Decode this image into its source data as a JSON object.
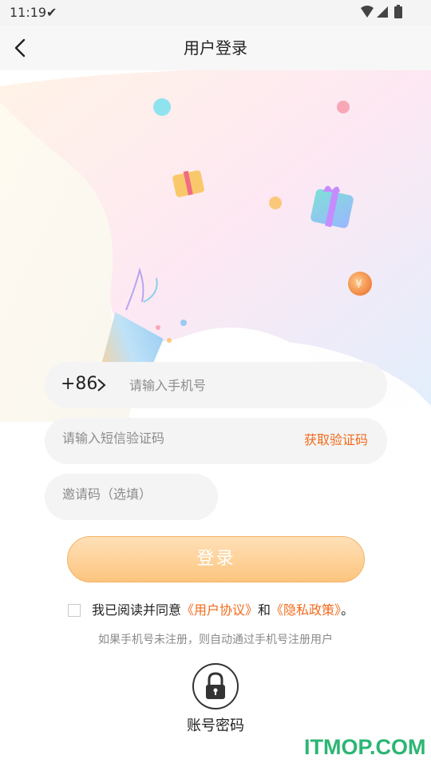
{
  "status_bar": {
    "time": "11:19",
    "check_icon": "checkmark-download-icon",
    "icons": [
      "wifi-icon",
      "signal-icon",
      "battery-icon"
    ]
  },
  "header": {
    "back_icon": "chevron-left-icon",
    "title": "用户登录"
  },
  "hero": {
    "description_icons": [
      "party-popper-icon",
      "gift-box-icon",
      "coin-icon",
      "bubble-icon"
    ]
  },
  "form": {
    "country_code": "+86",
    "phone_placeholder": "请输入手机号",
    "sms_placeholder": "请输入短信验证码",
    "get_code_label": "获取验证码",
    "invite_placeholder": "邀请码（选填）",
    "login_label": "登录"
  },
  "agreement": {
    "prefix": "我已阅读并同意",
    "user_agreement": "《用户协议》",
    "conjunction": "和",
    "privacy_policy": "《隐私政策》",
    "suffix": "。"
  },
  "note": "如果手机号未注册，则自动通过手机号注册用户",
  "account_login": {
    "icon": "lock-icon",
    "label": "账号密码"
  },
  "watermark": "ITMOP.COM",
  "colors": {
    "accent": "#f26a1b",
    "login_button": "#fcc57e",
    "field_background": "#f4f4f4"
  }
}
